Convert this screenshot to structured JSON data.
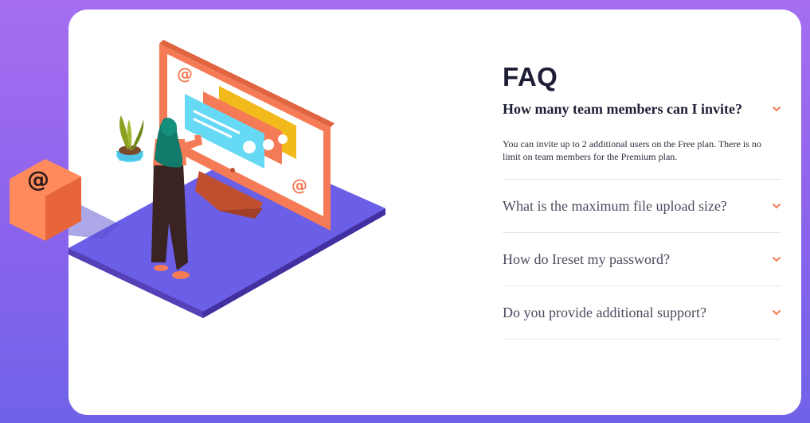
{
  "faq": {
    "title": "FAQ",
    "items": [
      {
        "question": "How many team members can I invite?",
        "answer": "You can invite up to 2 additional users on the Free plan. There is no limit on team members for the Premium plan.",
        "expanded": true
      },
      {
        "question": "What is the maximum file upload size?",
        "expanded": false
      },
      {
        "question": "How do Ireset my password?",
        "expanded": false
      },
      {
        "question": "Do you provide additional support?",
        "expanded": false
      }
    ]
  },
  "colors": {
    "accent": "#f47b56",
    "background_top": "#a66ef0",
    "background_bottom": "#6f63e8",
    "platform": "#6a5fe6",
    "heading": "#1d1e35"
  },
  "icons": {
    "chevron": "chevron-down-icon",
    "box": "at-sign-box-icon"
  }
}
